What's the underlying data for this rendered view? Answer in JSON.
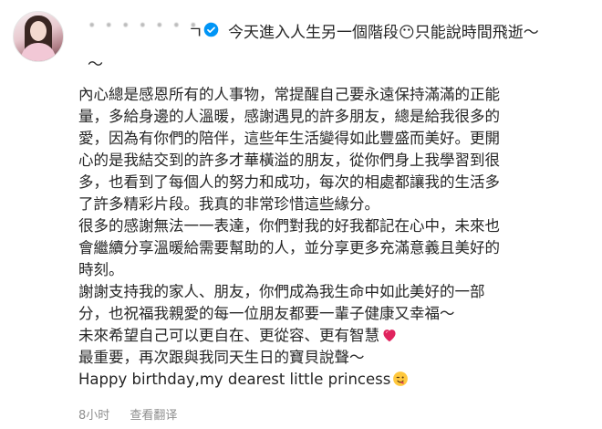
{
  "post": {
    "username_tail": "ㄱ",
    "caption_head": "今天進入人生另一個階段😶只能說時間飛逝～",
    "caption_tilde": "～",
    "lines": [
      "內心總是感恩所有的人事物，常提醒自己要永遠保持滿滿的正能",
      "量，多給身邊的人溫暖，感謝遇見的許多朋友，總是給我很多的",
      "愛，因為有你們的陪伴，這些年生活變得如此豐盛而美好。更開",
      "心的是我結交到的許多才華橫溢的朋友，從你們身上我學習到很",
      "多，也看到了每個人的努力和成功，每次的相處都讓我的生活多",
      "了許多精彩片段。我真的非常珍惜這些緣分。",
      "很多的感謝無法一一表達，你們對我的好我都記在心中，未來也",
      "會繼續分享溫暖給需要幫助的人，並分享更多充滿意義且美好的",
      "時刻。",
      "謝謝支持我的家人、朋友，你們成為我生命中如此美好的一部",
      "分，也祝福我親愛的每一位朋友都要一輩子健康又幸福～",
      "未來希望自己可以更自在、更從容、更有智慧",
      "最重要，再次跟與我同天生日的寶貝說聲～",
      "Happy birthday,my dearest little princess"
    ]
  },
  "footer": {
    "time": "8小时",
    "translate": "查看翻译"
  },
  "icons": {
    "verified": "verified-badge-icon",
    "heart": "red-heart-icon",
    "wink": "winking-face-icon"
  },
  "colors": {
    "text": "#262626",
    "muted": "#8e8e8e",
    "heart": "#e0245e"
  }
}
